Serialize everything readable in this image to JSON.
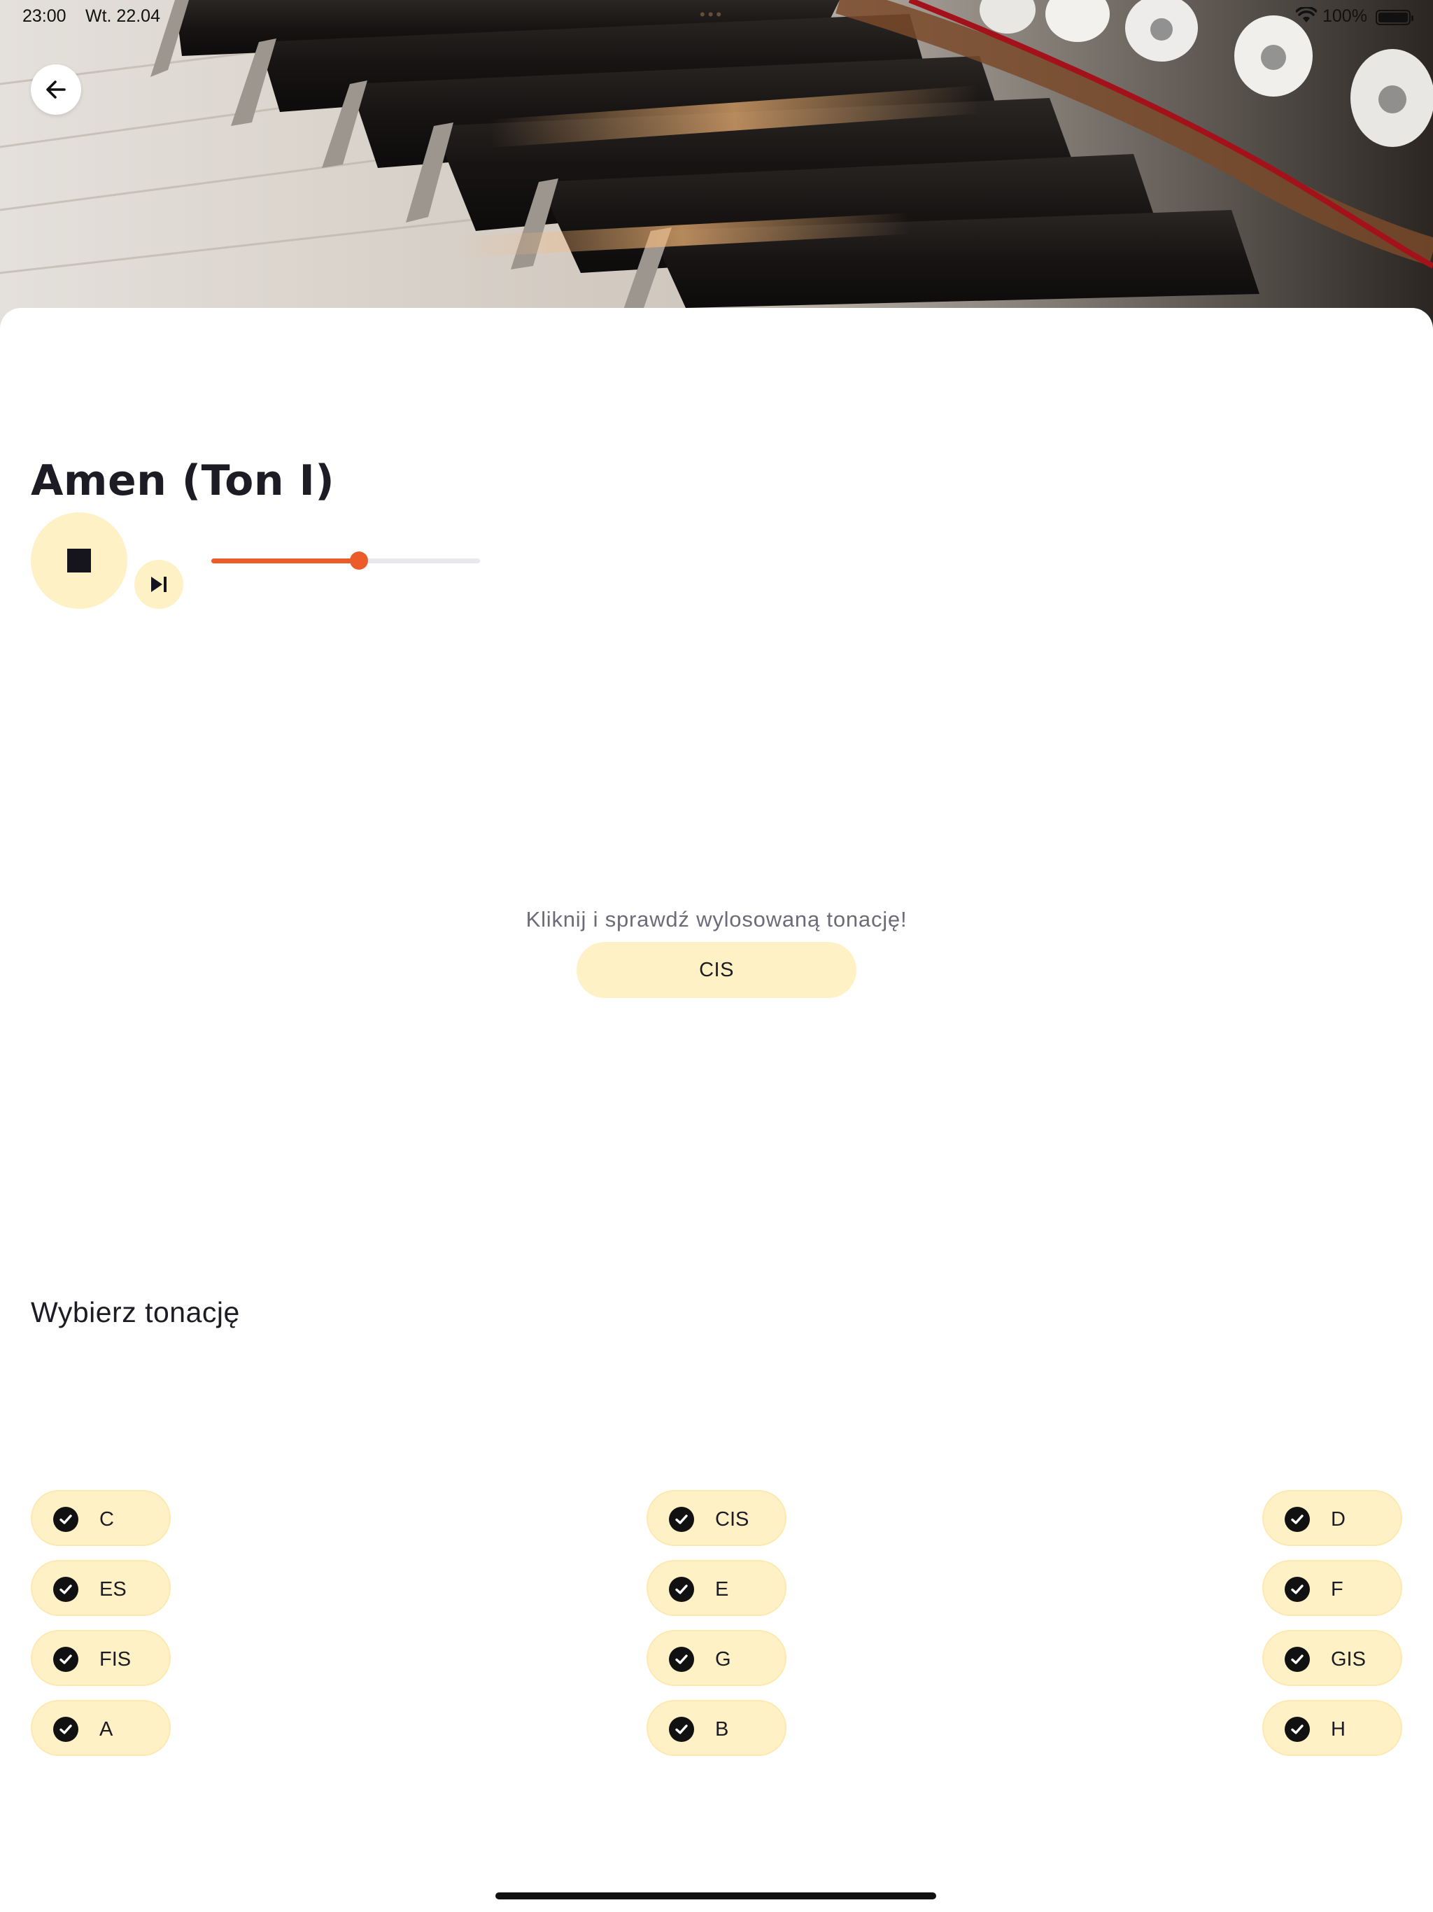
{
  "status_bar": {
    "time": "23:00",
    "date": "Wt. 22.04",
    "battery_pct": "100%"
  },
  "header": {
    "back_icon": "arrow-left-icon"
  },
  "player": {
    "title": "Amen (Ton I)",
    "stop_icon": "stop-icon",
    "skip_icon": "skip-next-icon",
    "progress": 0.55
  },
  "reveal": {
    "hint": "Kliknij i sprawdź wylosowaną tonację!",
    "button_label": "CIS"
  },
  "keys": {
    "section_title": "Wybierz tonację",
    "columns": [
      [
        "C",
        "ES",
        "FIS",
        "A"
      ],
      [
        "CIS",
        "E",
        "G",
        "B"
      ],
      [
        "D",
        "F",
        "GIS",
        "H"
      ]
    ]
  },
  "colors": {
    "accent": "#ec5b2a",
    "chip_bg": "#fff1c6",
    "text_dark": "#1d1b23",
    "hint_text": "#6e6b78"
  }
}
